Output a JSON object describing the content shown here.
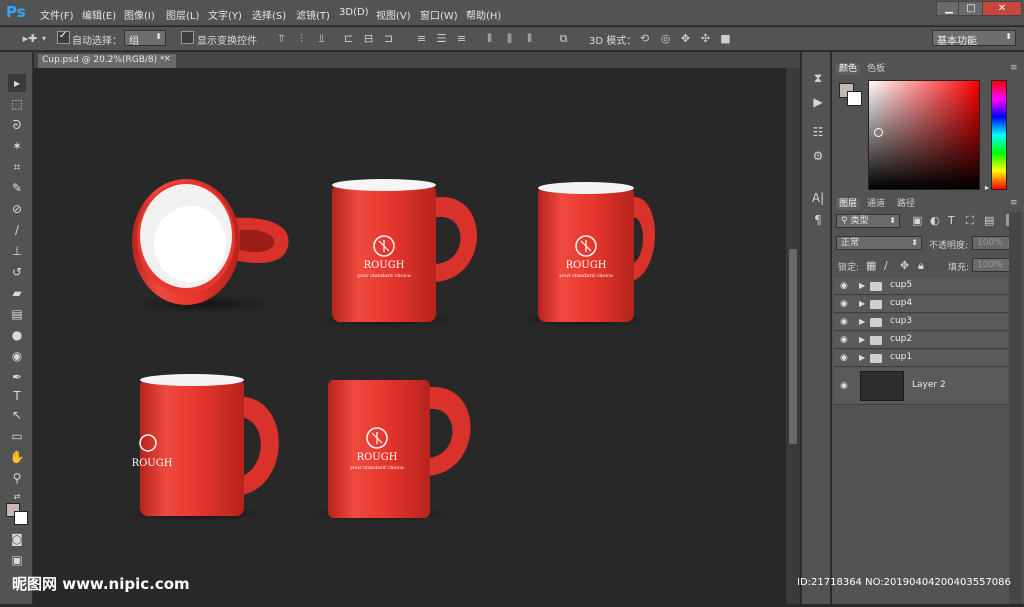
{
  "app": {
    "logo": "Ps"
  },
  "menu": [
    "文件(F)",
    "编辑(E)",
    "图像(I)",
    "图层(L)",
    "文字(Y)",
    "选择(S)",
    "滤镜(T)",
    "3D(D)",
    "视图(V)",
    "窗口(W)",
    "帮助(H)"
  ],
  "window_controls": {
    "minimize": "▁",
    "maximize": "□",
    "close": "✕"
  },
  "options": {
    "auto_select_label": "自动选择：",
    "auto_select_value": "组",
    "show_transform_label": "显示变换控件",
    "mode_3d_label": "3D 模式：",
    "workspace": "基本功能"
  },
  "document": {
    "tab_label": "Cup.psd @ 20.2%(RGB/8) *",
    "close": "×"
  },
  "panels": {
    "color_tabs": [
      "颜色",
      "色板"
    ],
    "layer_tabs": [
      "图层",
      "通道",
      "路径"
    ],
    "filter_kind": "类型",
    "blend_mode": "正常",
    "opacity_label": "不透明度:",
    "opacity_value": "100%",
    "lock_label": "锁定:",
    "fill_label": "填充:",
    "fill_value": "100%"
  },
  "layers": [
    {
      "name": "cup5",
      "type": "group"
    },
    {
      "name": "cup4",
      "type": "group"
    },
    {
      "name": "cup3",
      "type": "group"
    },
    {
      "name": "cup2",
      "type": "group"
    },
    {
      "name": "cup1",
      "type": "group"
    },
    {
      "name": "Layer 2",
      "type": "layer"
    }
  ],
  "mug_brand": {
    "logo_text": "ROUGH",
    "tagline": "your standard choice"
  },
  "colors": {
    "mug_red": "#e8372e",
    "canvas_bg": "#282828",
    "ui_gray": "#535353",
    "ps_blue": "#31a8ff"
  },
  "watermark": {
    "left": "昵图网 www.nipic.com",
    "right": "ID:21718364 NO:20190404200403557086"
  }
}
